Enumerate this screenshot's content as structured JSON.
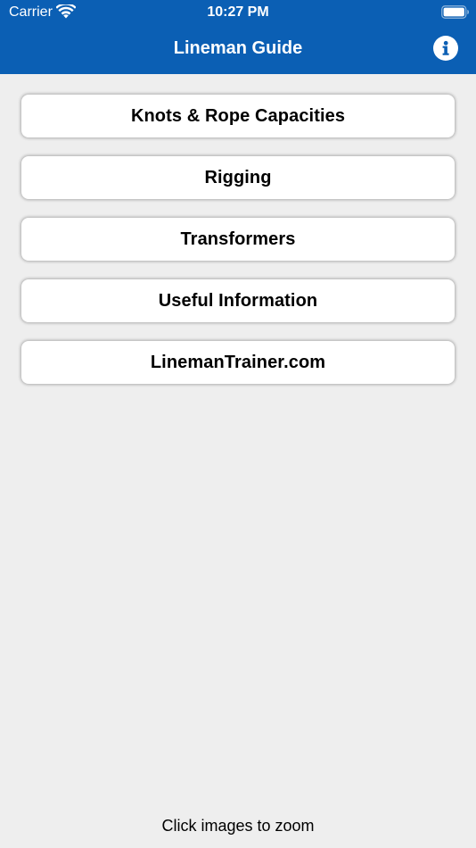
{
  "status_bar": {
    "carrier": "Carrier",
    "time": "10:27 PM",
    "icons": [
      "wifi-icon",
      "battery-icon"
    ]
  },
  "nav": {
    "title": "Lineman Guide",
    "info_icon": "info-icon"
  },
  "menu": {
    "items": [
      {
        "label": "Knots & Rope Capacities"
      },
      {
        "label": "Rigging"
      },
      {
        "label": "Transformers"
      },
      {
        "label": "Useful Information"
      },
      {
        "label": "LinemanTrainer.com"
      }
    ]
  },
  "footer": {
    "note": "Click images to zoom"
  },
  "colors": {
    "header": "#0b5fb4",
    "background": "#eeeeee",
    "button": "#ffffff",
    "text": "#000000"
  }
}
